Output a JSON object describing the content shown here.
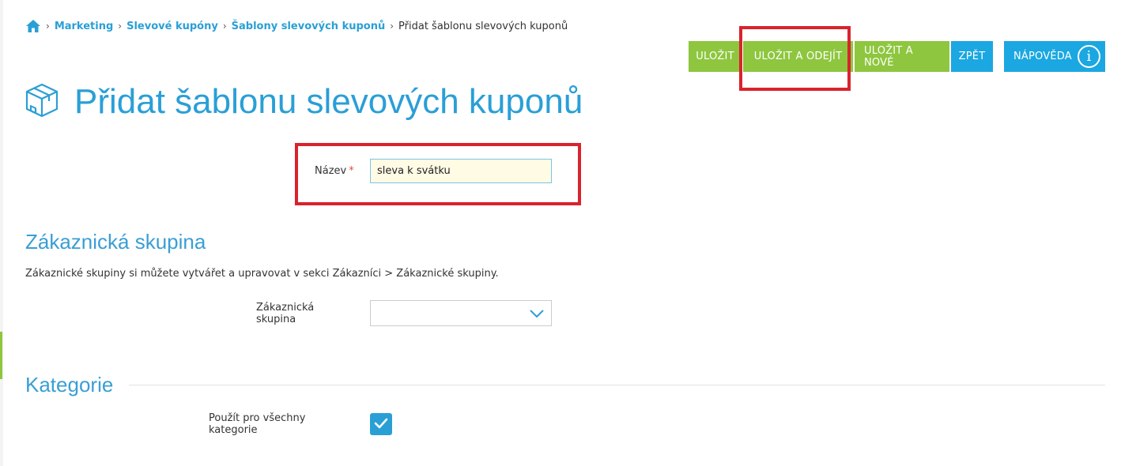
{
  "breadcrumb": {
    "items": [
      "Marketing",
      "Slevové kupóny",
      "Šablony slevových kuponů"
    ],
    "current": "Přidat šablonu slevových kuponů"
  },
  "toolbar": {
    "save": "ULOŽIT",
    "save_exit": "ULOŽIT A ODEJÍT",
    "save_new": "ULOŽIT A NOVÉ",
    "back": "ZPĚT",
    "help": "NÁPOVĚDA"
  },
  "page": {
    "title": "Přidat šablonu slevových kuponů"
  },
  "form": {
    "name_label": "Název",
    "name_required": "*",
    "name_value": "sleva k svátku"
  },
  "customer_group": {
    "title": "Zákaznická skupina",
    "description": "Zákaznické skupiny si můžete vytvářet a upravovat v sekci Zákazníci > Zákaznické skupiny.",
    "field_label": "Zákaznická skupina",
    "selected": ""
  },
  "categories": {
    "title": "Kategorie",
    "all_label": "Použít pro všechny kategorie",
    "all_checked": true
  },
  "colors": {
    "accent_blue": "#2a9fd6",
    "button_green": "#8ec63f",
    "button_blue": "#1ba7e1",
    "annotation_red": "#d9232d"
  },
  "icons": [
    "home-icon",
    "box-icon",
    "info-icon",
    "chevron-down-icon",
    "checkmark-icon"
  ]
}
